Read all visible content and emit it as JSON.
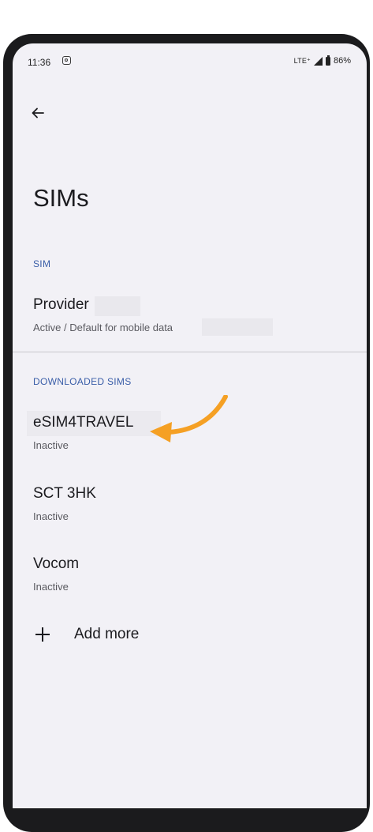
{
  "status_bar": {
    "time": "11:36",
    "network": "LTE⁺",
    "battery": "86%"
  },
  "page": {
    "title": "SIMs"
  },
  "sim_section": {
    "header": "SIM",
    "items": [
      {
        "title": "Provider",
        "subtitle": "Active / Default for mobile data"
      }
    ]
  },
  "downloaded_section": {
    "header": "DOWNLOADED SIMS",
    "items": [
      {
        "title": "eSIM4TRAVEL",
        "subtitle": "Inactive"
      },
      {
        "title": "SCT 3HK",
        "subtitle": "Inactive"
      },
      {
        "title": "Vocom",
        "subtitle": "Inactive"
      }
    ]
  },
  "add_more": {
    "label": "Add more"
  },
  "colors": {
    "accent": "#3a5ea8",
    "highlight_arrow": "#f5a024",
    "screen_bg": "#f2f1f6"
  },
  "icons": [
    "back-arrow-icon",
    "instagram-icon",
    "signal-icon",
    "battery-icon",
    "plus-icon",
    "pointer-arrow-icon"
  ]
}
